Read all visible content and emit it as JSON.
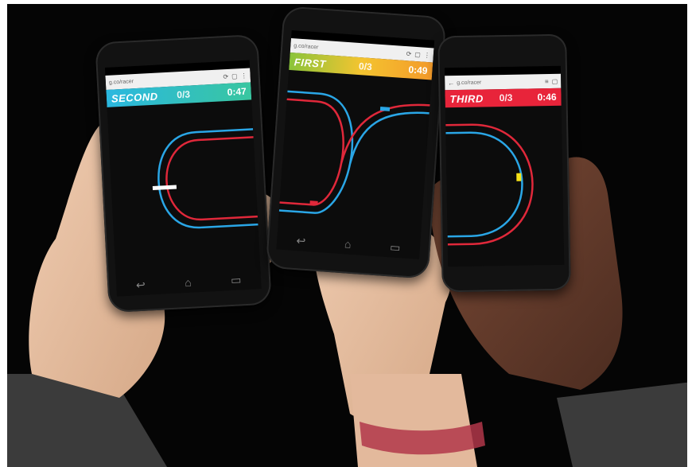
{
  "phones": [
    {
      "id": "left",
      "url": "g.co/racer",
      "place": "SECOND",
      "laps": "0/3",
      "time": "0:47",
      "bar_color": "#2bb8e0",
      "bar_gradient_end": "#39c6a0"
    },
    {
      "id": "center",
      "url": "g.co/racer",
      "place": "FIRST",
      "laps": "0/3",
      "time": "0:49",
      "bar_color": "#f4c430",
      "bar_gradient_start": "#8ac43a",
      "bar_gradient_end": "#f39a2a"
    },
    {
      "id": "right",
      "url": "g.co/racer",
      "place": "THIRD",
      "laps": "0/3",
      "time": "0:46",
      "bar_color": "#e8243a"
    }
  ],
  "colors": {
    "background": "#050505",
    "track_blue": "#2aa6e6",
    "track_red": "#e0283a",
    "car_yellow": "#f6e218",
    "skin_light": "#e6c2a6",
    "skin_dark": "#6a4030",
    "sleeve": "#3a3a3a"
  },
  "icons": [
    "refresh-icon",
    "tabs-icon",
    "menu-icon",
    "back-icon",
    "home-icon",
    "recent-apps-icon"
  ]
}
